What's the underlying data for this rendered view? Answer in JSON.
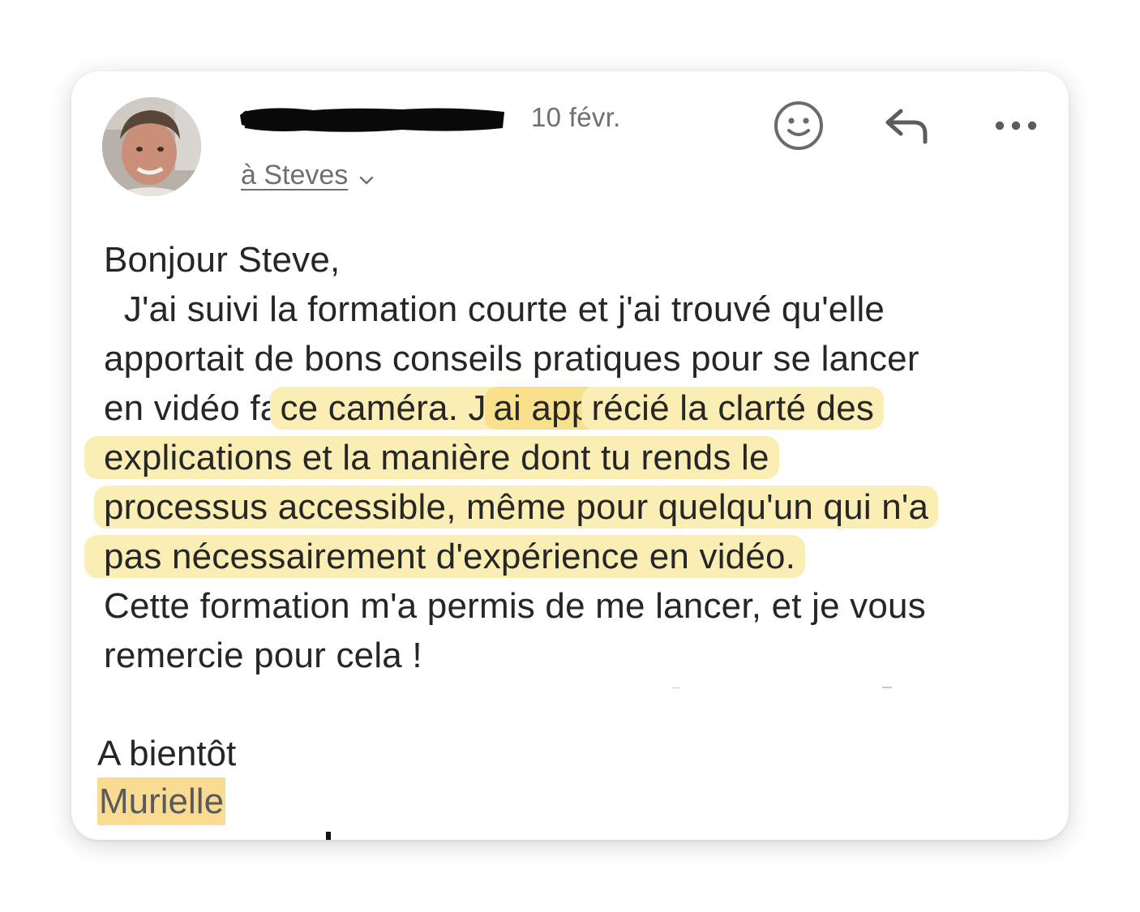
{
  "header": {
    "date": "10 févr.",
    "recipient": "à Steves"
  },
  "actions": {
    "emoji_icon": "smiley-icon",
    "reply_icon": "reply-icon",
    "more_icon": "more-horizontal-icon"
  },
  "message": {
    "lines": [
      "Bonjour Steve,",
      "  J'ai suivi la formation courte et j'ai trouvé qu'elle",
      "apportait de bons conseils pratiques pour se lancer",
      "en vidéo fa",
      "ce caméra. J'",
      "ai app",
      "récié la clarté des",
      "explications et la manière dont tu rends le",
      "processus accessible, même pour quelqu'un qui n'a",
      "pas nécessairement d'expérience en vidéo.",
      "Cette formation m'a permis de me lancer, et je vous",
      "remercie pour cela !"
    ],
    "signoff": "A bientôt",
    "signature": "Murielle"
  },
  "colors": {
    "highlight_light": "#fbeeb4",
    "highlight_strong": "#f9e08d",
    "signature_highlight": "#f9dc92",
    "secondary_text": "#6f6f6f",
    "body_text": "#262626"
  }
}
